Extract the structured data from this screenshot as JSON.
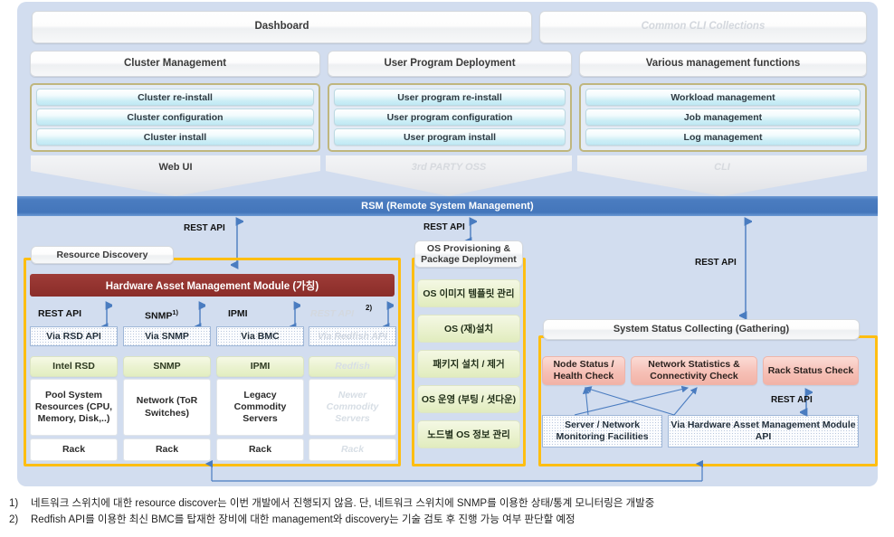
{
  "top": {
    "dashboard": "Dashboard",
    "common_cli": "Common CLI Collections",
    "groups": [
      {
        "title": "Cluster Management",
        "items": [
          "Cluster re-install",
          "Cluster configuration",
          "Cluster install"
        ],
        "banner": "Web UI"
      },
      {
        "title": "User Program Deployment",
        "items": [
          "User program re-install",
          "User program configuration",
          "User program install"
        ],
        "banner": "3rd PARTY OSS"
      },
      {
        "title": "Various management functions",
        "items": [
          "Workload management",
          "Job management",
          "Log management"
        ],
        "banner": "CLI"
      }
    ]
  },
  "rsm": {
    "label": "RSM (Remote System Management)"
  },
  "arrows": {
    "rest_api_left": "REST API",
    "rest_api_mid": "REST API",
    "rest_api_right": "REST API",
    "rest_api_status": "REST API"
  },
  "resource_discovery": {
    "tag": "Resource Discovery",
    "module_header": "Hardware Asset Management Module (가칭)",
    "protocols": [
      "REST API",
      "SNMP",
      "IPMI",
      "REST API"
    ],
    "protocol_sups": [
      "",
      "1)",
      "",
      "2)"
    ],
    "vias": [
      "Via RSD API",
      "Via SNMP",
      "Via BMC",
      "Via Redfish API"
    ],
    "stacks": [
      {
        "proto": "Intel RSD",
        "target": "Pool System Resources (CPU, Memory, Disk,..)",
        "rack": "Rack"
      },
      {
        "proto": "SNMP",
        "target": "Network (ToR Switches)",
        "rack": "Rack"
      },
      {
        "proto": "IPMI",
        "target": "Legacy Commodity Servers",
        "rack": "Rack"
      },
      {
        "proto": "Redfish",
        "target": "Newer Commodity Servers",
        "rack": "Rack"
      }
    ]
  },
  "os_provisioning": {
    "tag": "OS Provisioning & Package Deployment",
    "items": [
      "OS 이미지 템플릿 관리",
      "OS (재)설치",
      "패키지 설치 / 제거",
      "OS 운영 (부팅 / 셧다운)",
      "노드별 OS 정보 관리"
    ]
  },
  "status_collecting": {
    "tag": "System Status Collecting (Gathering)",
    "checks": [
      "Node Status / Health Check",
      "Network Statistics & Connectivity Check",
      "Rack Status Check"
    ],
    "sources": [
      "Server / Network Monitoring Facilities",
      "Via Hardware Asset Management Module  API"
    ]
  },
  "footnotes": [
    {
      "num": "1)",
      "text": "네트워크 스위치에 대한 resource discover는 이번 개발에서 진행되지 않음. 단, 네트워크 스위치에 SNMP를 이용한 상태/통계 모니터링은 개발중"
    },
    {
      "num": "2)",
      "text": "Redfish API를 이용한 최신 BMC를 탑재한 장비에 대한 management와  discovery는 기술 검토 후 진행 가능 여부 판단할 예정"
    }
  ],
  "colors": {
    "panel": "#d2ddef",
    "rsm": "#4a7cc0",
    "orange": "#ffbe12",
    "module_header": "#93332f",
    "pink": "#f6c0b6",
    "green": "#e9f1cd",
    "cyan": "#cdeef6",
    "khaki": "#bfb67e"
  }
}
